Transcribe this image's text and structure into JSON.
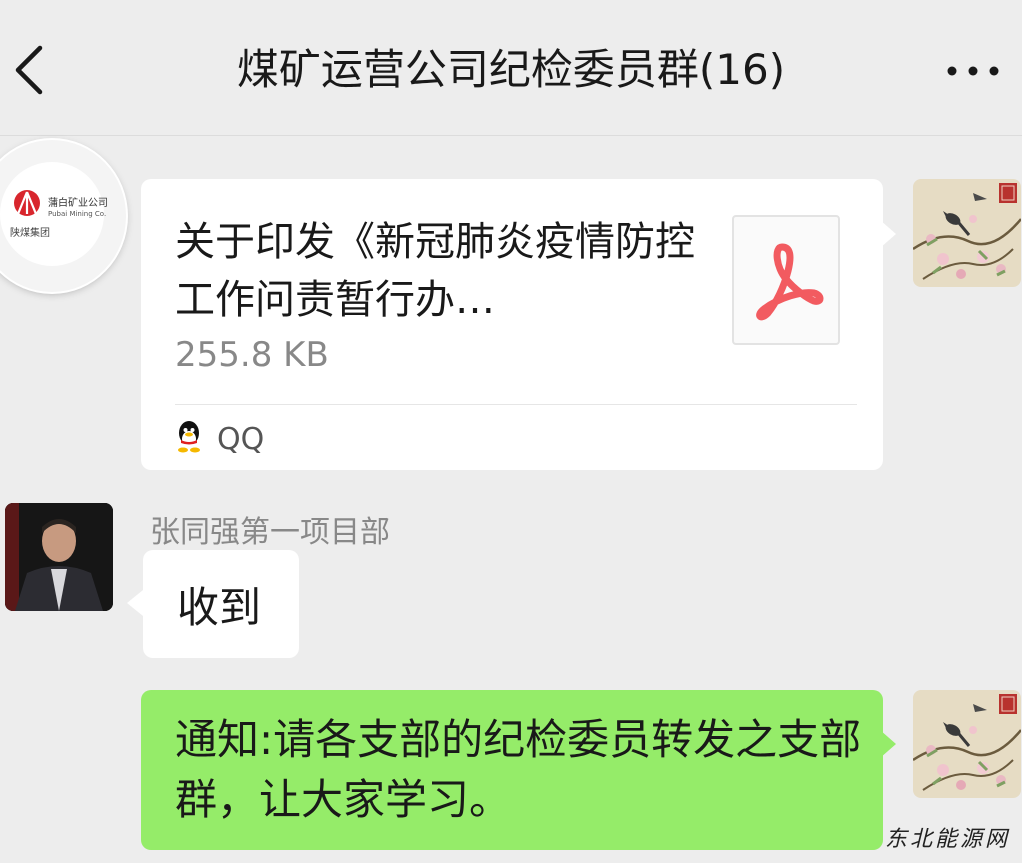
{
  "header": {
    "title": "煤矿运营公司纪检委员群(16)",
    "back_icon": "chevron-left-icon",
    "more_icon": "more-dots-icon"
  },
  "logo_avatar": {
    "name_cn": "蒲白矿业公司",
    "name_en": "Pubai Mining Co.",
    "group_text": "陕煤集团"
  },
  "messages": [
    {
      "type": "file",
      "side": "right",
      "file_name": "关于印发《新冠肺炎疫情防控工作问责暂行办…",
      "file_size": "255.8 KB",
      "file_icon": "pdf-icon",
      "source_label": "QQ",
      "source_icon": "qq-penguin-icon"
    },
    {
      "type": "text",
      "side": "left",
      "sender": "张同强第一项目部",
      "text": "收到"
    },
    {
      "type": "text",
      "side": "right",
      "text": "通知:请各支部的纪检委员转发之支部群，让大家学习。"
    }
  ],
  "watermark": "东北能源网",
  "colors": {
    "background": "#ededed",
    "sent_bubble": "#95ec69",
    "received_bubble": "#ffffff",
    "pdf_red": "#f25b60"
  }
}
